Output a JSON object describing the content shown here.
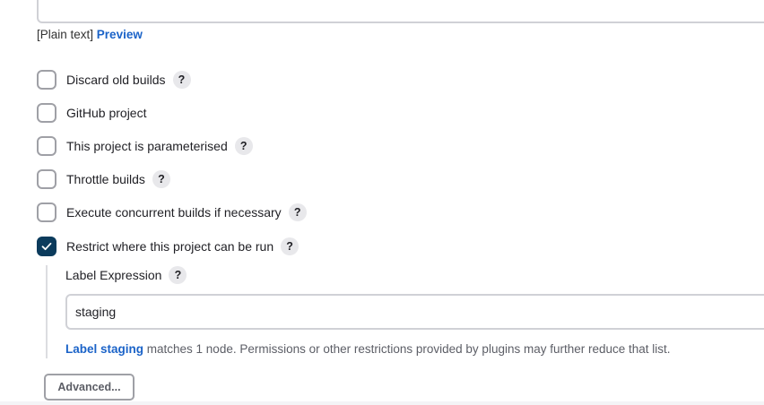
{
  "description_format": {
    "prefix": "[Plain text]",
    "preview_link": "Preview"
  },
  "options": [
    {
      "id": "discard-old-builds",
      "label": "Discard old builds",
      "checked": false,
      "help": "?"
    },
    {
      "id": "github-project",
      "label": "GitHub project",
      "checked": false,
      "help": ""
    },
    {
      "id": "parameterised",
      "label": "This project is parameterised",
      "checked": false,
      "help": "?"
    },
    {
      "id": "throttle-builds",
      "label": "Throttle builds",
      "checked": false,
      "help": "?"
    },
    {
      "id": "concurrent-builds",
      "label": "Execute concurrent builds if necessary",
      "checked": false,
      "help": "?"
    },
    {
      "id": "restrict-where",
      "label": "Restrict where this project can be run",
      "checked": true,
      "help": "?"
    }
  ],
  "label_expression": {
    "label": "Label Expression",
    "help": "?",
    "value": "staging",
    "match_link": "Label staging",
    "match_text": " matches 1 node. Permissions or other restrictions provided by plugins may further reduce that list."
  },
  "advanced_button": "Advanced...",
  "colors": {
    "accent": "#0b3b5c",
    "link": "#1b63c8"
  },
  "icons": {
    "checkmark": "check-icon",
    "help": "question-mark-icon"
  }
}
